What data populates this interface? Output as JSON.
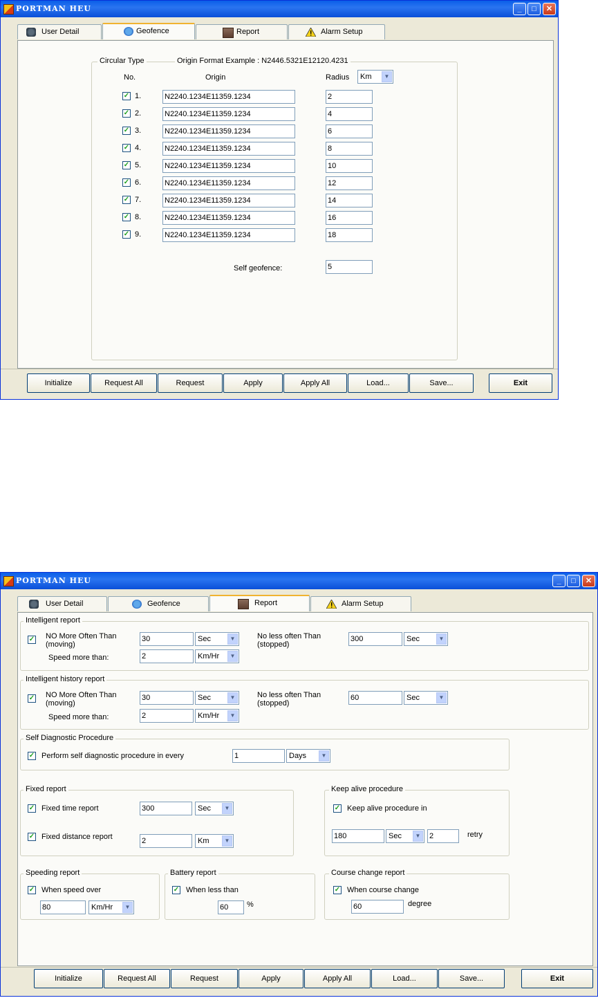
{
  "window_title": "PORTMAN HEU",
  "tabs": [
    "User Detail",
    "Geofence",
    "Report",
    "Alarm Setup"
  ],
  "buttons": [
    "Initialize",
    "Request All",
    "Request",
    "Apply",
    "Apply All",
    "Load...",
    "Save...",
    "Exit"
  ],
  "geofence": {
    "group_title": "Circular Type",
    "origin_format": "Origin Format  Example : N2446.5321E12120.4231",
    "col_no": "No.",
    "col_origin": "Origin",
    "col_radius": "Radius",
    "radius_unit": "Km",
    "rows": [
      {
        "no": "1.",
        "origin": "N2240.1234E11359.1234",
        "radius": "2",
        "checked": true
      },
      {
        "no": "2.",
        "origin": "N2240.1234E11359.1234",
        "radius": "4",
        "checked": true
      },
      {
        "no": "3.",
        "origin": "N2240.1234E11359.1234",
        "radius": "6",
        "checked": true
      },
      {
        "no": "4.",
        "origin": "N2240.1234E11359.1234",
        "radius": "8",
        "checked": true
      },
      {
        "no": "5.",
        "origin": "N2240.1234E11359.1234",
        "radius": "10",
        "checked": true
      },
      {
        "no": "6.",
        "origin": "N2240.1234E11359.1234",
        "radius": "12",
        "checked": true
      },
      {
        "no": "7.",
        "origin": "N2240.1234E11359.1234",
        "radius": "14",
        "checked": true
      },
      {
        "no": "8.",
        "origin": "N2240.1234E11359.1234",
        "radius": "16",
        "checked": true
      },
      {
        "no": "9.",
        "origin": "N2240.1234E11359.1234",
        "radius": "18",
        "checked": true
      }
    ],
    "self_label": "Self geofence:",
    "self_value": "5"
  },
  "report": {
    "intelligent": {
      "title": "Intelligent report",
      "nmot_label": "NO More Often Than\n(moving)",
      "nmot_value": "30",
      "nmot_unit": "Sec",
      "nlot_label": "No less often Than\n(stopped)",
      "nlot_value": "300",
      "nlot_unit": "Sec",
      "speed_label": "Speed more than:",
      "speed_value": "2",
      "speed_unit": "Km/Hr"
    },
    "history": {
      "title": "Intelligent history report",
      "nmot_label": "NO More Often Than\n(moving)",
      "nmot_value": "30",
      "nmot_unit": "Sec",
      "nlot_label": "No less often Than\n(stopped)",
      "nlot_value": "60",
      "nlot_unit": "Sec",
      "speed_label": "Speed more than:",
      "speed_value": "2",
      "speed_unit": "Km/Hr"
    },
    "diag": {
      "title": "Self Diagnostic Procedure",
      "label": "Perform self diagnostic procedure in every",
      "value": "1",
      "unit": "Days"
    },
    "fixed": {
      "title": "Fixed report",
      "time_label": "Fixed time report",
      "time_value": "300",
      "time_unit": "Sec",
      "dist_label": "Fixed distance report",
      "dist_value": "2",
      "dist_unit": "Km"
    },
    "keepalive": {
      "title": "Keep alive procedure",
      "label": "Keep alive procedure in",
      "value": "180",
      "unit": "Sec",
      "retry_value": "2",
      "retry_label": "retry"
    },
    "speeding": {
      "title": "Speeding report",
      "label": "When speed over",
      "value": "80",
      "unit": "Km/Hr"
    },
    "battery": {
      "title": "Battery report",
      "label": "When less than",
      "value": "60",
      "unit": "%"
    },
    "course": {
      "title": "Course change report",
      "label": "When course change",
      "value": "60",
      "unit": "degree"
    }
  }
}
